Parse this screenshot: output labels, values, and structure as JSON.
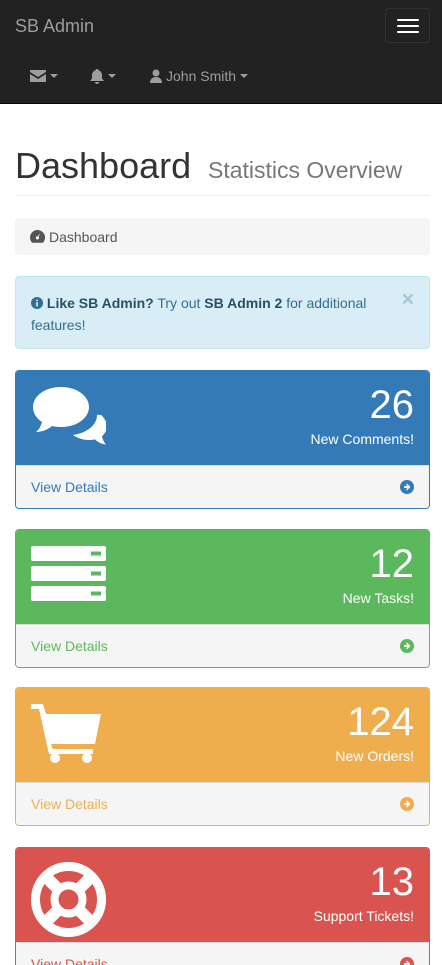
{
  "navbar": {
    "brand": "SB Admin",
    "user_name": "John Smith",
    "envelope_icon": "envelope-icon",
    "bell_icon": "bell-icon",
    "user_icon": "user-icon",
    "toggle_icon": "hamburger-icon"
  },
  "header": {
    "title": "Dashboard",
    "subtitle": "Statistics Overview"
  },
  "breadcrumb": {
    "label": "Dashboard",
    "icon": "dashboard-icon"
  },
  "alert": {
    "strong": "Like SB Admin?",
    "text_1": " Try out ",
    "link": "SB Admin 2",
    "text_2": " for additional features!",
    "close": "×",
    "icon": "info-circle-icon"
  },
  "panels": [
    {
      "count": "26",
      "label": "New Comments!",
      "footer": "View Details",
      "icon": "comments-icon",
      "color": "#337ab7"
    },
    {
      "count": "12",
      "label": "New Tasks!",
      "footer": "View Details",
      "icon": "tasks-icon",
      "color": "#5cb85c"
    },
    {
      "count": "124",
      "label": "New Orders!",
      "footer": "View Details",
      "icon": "shopping-cart-icon",
      "color": "#f0ad4e"
    },
    {
      "count": "13",
      "label": "Support Tickets!",
      "footer": "View Details",
      "icon": "life-ring-icon",
      "color": "#d9534f"
    }
  ]
}
